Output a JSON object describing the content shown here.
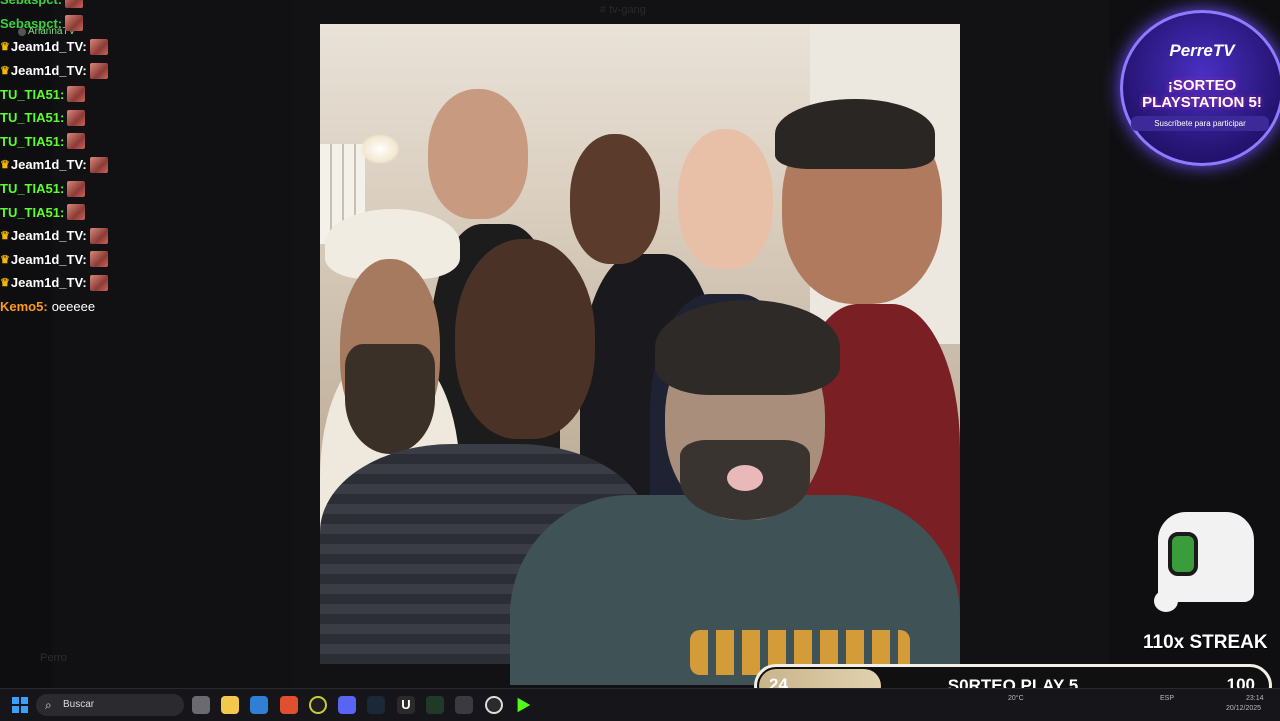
{
  "background": {
    "window_title": "# tv-gang",
    "user_label": "Perro"
  },
  "chat": {
    "header_user": "AriannaTV",
    "messages": [
      {
        "user": "Sebaspct:",
        "color": "#3ed13e",
        "crown": false,
        "text": ""
      },
      {
        "user": "Sebaspct:",
        "color": "#3ed13e",
        "crown": false,
        "text": ""
      },
      {
        "user": "Jeam1d_TV:",
        "color": "#ffffff",
        "crown": true,
        "text": ""
      },
      {
        "user": "Jeam1d_TV:",
        "color": "#ffffff",
        "crown": true,
        "text": ""
      },
      {
        "user": "TU_TIA51:",
        "color": "#5bff2e",
        "crown": false,
        "text": ""
      },
      {
        "user": "TU_TIA51:",
        "color": "#5bff2e",
        "crown": false,
        "text": ""
      },
      {
        "user": "TU_TIA51:",
        "color": "#5bff2e",
        "crown": false,
        "text": ""
      },
      {
        "user": "Jeam1d_TV:",
        "color": "#ffffff",
        "crown": true,
        "text": ""
      },
      {
        "user": "TU_TIA51:",
        "color": "#5bff2e",
        "crown": false,
        "text": ""
      },
      {
        "user": "TU_TIA51:",
        "color": "#5bff2e",
        "crown": false,
        "text": ""
      },
      {
        "user": "Jeam1d_TV:",
        "color": "#ffffff",
        "crown": true,
        "text": ""
      },
      {
        "user": "Jeam1d_TV:",
        "color": "#ffffff",
        "crown": true,
        "text": ""
      },
      {
        "user": "Jeam1d_TV:",
        "color": "#ffffff",
        "crown": true,
        "text": ""
      },
      {
        "user": "Kemo5:",
        "color": "#ff9a1f",
        "crown": false,
        "text": "oeeeee"
      }
    ]
  },
  "badge": {
    "brand": "PerreTV",
    "title_line1": "¡SORTEO",
    "title_line2": "PLAYSTATION 5!",
    "subtitle": "Suscríbete para participar"
  },
  "streak": {
    "label": "110x STREAK"
  },
  "progress": {
    "label": "S0RTEO PLAY 5",
    "start": "24",
    "end": "100",
    "fraction": 0.24
  },
  "taskbar": {
    "search_placeholder": "Buscar",
    "weather": "20°C",
    "language": "ESP",
    "time": "23:14",
    "date": "20/12/2025"
  }
}
